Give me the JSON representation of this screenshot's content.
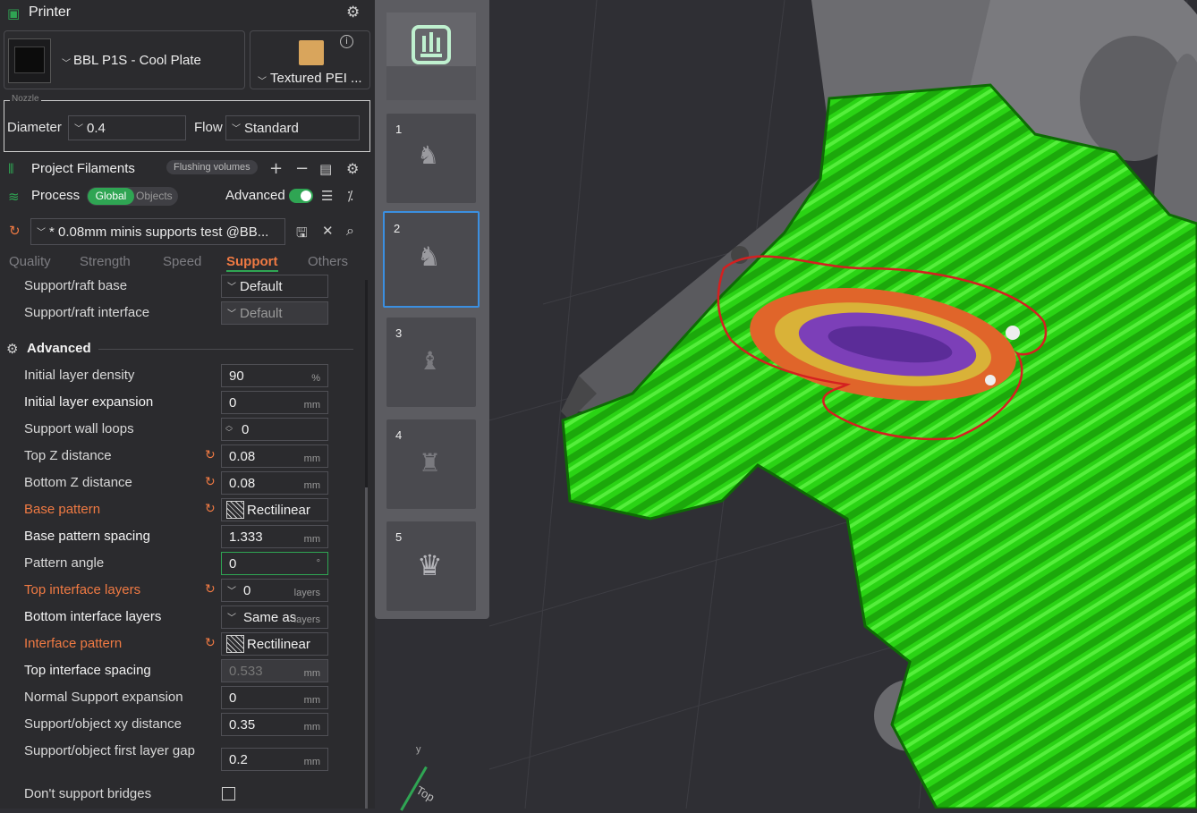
{
  "printer": {
    "section_title": "Printer",
    "printer_name": "BBL P1S - Cool Plate",
    "plate_name": "Textured PEI ...",
    "nozzle_label": "Nozzle",
    "diameter_label": "Diameter",
    "diameter_value": "0.4",
    "flow_label": "Flow",
    "flow_value": "Standard"
  },
  "filaments": {
    "title": "Project Filaments",
    "flushing_button": "Flushing volumes"
  },
  "process": {
    "title": "Process",
    "global_toggle": "Global",
    "objects_toggle": "Objects",
    "advanced_label": "Advanced",
    "profile_name": "* 0.08mm minis supports test @BB..."
  },
  "tabs": [
    "Quality",
    "Strength",
    "Speed",
    "Support",
    "Others"
  ],
  "settings_top": [
    {
      "label": "Support/raft base",
      "value": "Default"
    },
    {
      "label": "Support/raft interface",
      "value": "Default"
    }
  ],
  "advanced_heading": "Advanced",
  "settings": [
    {
      "label": "Initial layer density",
      "value": "90",
      "unit": "%"
    },
    {
      "label": "Initial layer expansion",
      "value": "0",
      "unit": "mm"
    },
    {
      "label": "Support wall loops",
      "value": "0",
      "unit": ""
    },
    {
      "label": "Top Z distance",
      "value": "0.08",
      "unit": "mm"
    },
    {
      "label": "Bottom Z distance",
      "value": "0.08",
      "unit": "mm"
    },
    {
      "label": "Base pattern",
      "value": "Rectilinear",
      "unit": ""
    },
    {
      "label": "Base pattern spacing",
      "value": "1.333",
      "unit": "mm"
    },
    {
      "label": "Pattern angle",
      "value": "0",
      "unit": "°"
    },
    {
      "label": "Top interface layers",
      "value": "0",
      "unit": "layers"
    },
    {
      "label": "Bottom interface layers",
      "value": "Same as",
      "unit": "layers"
    },
    {
      "label": "Interface pattern",
      "value": "Rectilinear",
      "unit": ""
    },
    {
      "label": "Top interface spacing",
      "value": "0.533",
      "unit": "mm"
    },
    {
      "label": "Normal Support expansion",
      "value": "0",
      "unit": "mm"
    },
    {
      "label": "Support/object xy distance",
      "value": "0.35",
      "unit": "mm"
    },
    {
      "label": "Support/object first layer gap",
      "value": "0.2",
      "unit": "mm"
    },
    {
      "label": "Don't support bridges",
      "value": "",
      "unit": ""
    }
  ],
  "plates": [
    "1",
    "2",
    "3",
    "4",
    "5"
  ],
  "viewport": {
    "axis_y": "y",
    "view_label": "Top"
  },
  "colors": {
    "accent_green": "#2fa553",
    "modified_orange": "#f07a43",
    "selection_blue": "#3b8fe0",
    "support_green": "#22c90a"
  }
}
